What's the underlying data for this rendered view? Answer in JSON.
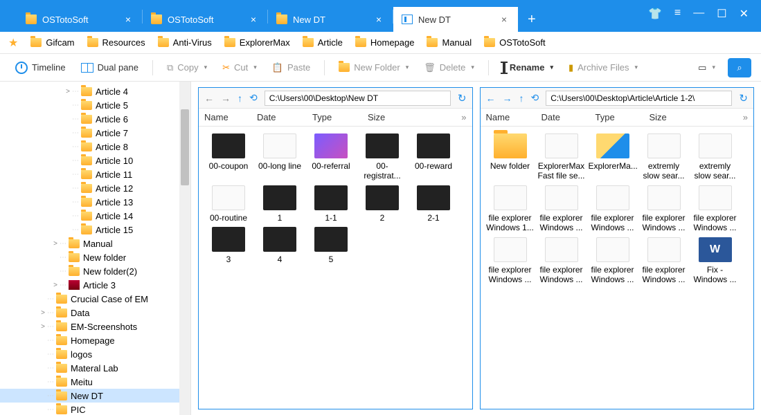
{
  "tabs": [
    {
      "label": "OSTotoSoft",
      "active": false
    },
    {
      "label": "OSTotoSoft",
      "active": false
    },
    {
      "label": "New DT",
      "active": false
    },
    {
      "label": "New DT",
      "active": true
    }
  ],
  "bookmarks": [
    "Gifcam",
    "Resources",
    "Anti-Virus",
    "ExplorerMax",
    "Article",
    "Homepage",
    "Manual",
    "OSTotoSoft"
  ],
  "toolbar": {
    "timeline": "Timeline",
    "dualpane": "Dual pane",
    "copy": "Copy",
    "cut": "Cut",
    "paste": "Paste",
    "newfolder": "New Folder",
    "delete": "Delete",
    "rename": "Rename",
    "archive": "Archive Files"
  },
  "tree": [
    {
      "indent": 3,
      "exp": ">",
      "label": "Article 4"
    },
    {
      "indent": 3,
      "exp": "",
      "label": "Article 5"
    },
    {
      "indent": 3,
      "exp": "",
      "label": "Article 6"
    },
    {
      "indent": 3,
      "exp": "",
      "label": "Article 7"
    },
    {
      "indent": 3,
      "exp": "",
      "label": "Article 8"
    },
    {
      "indent": 3,
      "exp": "",
      "label": "Article 10"
    },
    {
      "indent": 3,
      "exp": "",
      "label": "Article 11"
    },
    {
      "indent": 3,
      "exp": "",
      "label": "Article 12"
    },
    {
      "indent": 3,
      "exp": "",
      "label": "Article 13"
    },
    {
      "indent": 3,
      "exp": "",
      "label": "Article 14"
    },
    {
      "indent": 3,
      "exp": "",
      "label": "Article 15"
    },
    {
      "indent": 2,
      "exp": ">",
      "label": "Manual"
    },
    {
      "indent": 2,
      "exp": "",
      "label": "New folder"
    },
    {
      "indent": 2,
      "exp": "",
      "label": "New folder(2)"
    },
    {
      "indent": 2,
      "exp": ">",
      "label": "Article 3",
      "icon": "rar"
    },
    {
      "indent": 1,
      "exp": "",
      "label": "Crucial Case of EM"
    },
    {
      "indent": 1,
      "exp": ">",
      "label": "Data"
    },
    {
      "indent": 1,
      "exp": ">",
      "label": "EM-Screenshots"
    },
    {
      "indent": 1,
      "exp": "",
      "label": "Homepage"
    },
    {
      "indent": 1,
      "exp": "",
      "label": "logos"
    },
    {
      "indent": 1,
      "exp": "",
      "label": "Materal Lab"
    },
    {
      "indent": 1,
      "exp": "",
      "label": "Meitu"
    },
    {
      "indent": 1,
      "exp": "",
      "label": "New DT",
      "sel": true
    },
    {
      "indent": 1,
      "exp": "",
      "label": "PIC"
    }
  ],
  "left": {
    "path": "C:\\Users\\00\\Desktop\\New DT",
    "cols": [
      "Name",
      "Date",
      "Type",
      "Size"
    ],
    "items": [
      {
        "label": "00-coupon",
        "t": "dark"
      },
      {
        "label": "00-long line",
        "t": "light"
      },
      {
        "label": "00-referral",
        "t": "purple"
      },
      {
        "label": "00-registrat...",
        "t": "dark"
      },
      {
        "label": "00-reward",
        "t": "dark"
      },
      {
        "label": "00-routine",
        "t": "light"
      },
      {
        "label": "1",
        "t": "dark"
      },
      {
        "label": "1-1",
        "t": "dark"
      },
      {
        "label": "2",
        "t": "dark"
      },
      {
        "label": "2-1",
        "t": "dark"
      },
      {
        "label": "3",
        "t": "dark"
      },
      {
        "label": "4",
        "t": "dark"
      },
      {
        "label": "5",
        "t": "dark"
      }
    ]
  },
  "right": {
    "path": "C:\\Users\\00\\Desktop\\Article\\Article 1-2\\",
    "cols": [
      "Name",
      "Date",
      "Type",
      "Size"
    ],
    "items": [
      {
        "label": "New folder",
        "t": "folder"
      },
      {
        "label": "ExplorerMax Fast file se...",
        "t": "light"
      },
      {
        "label": "ExplorerMa...",
        "t": "shield"
      },
      {
        "label": "extremly slow sear...",
        "t": "light"
      },
      {
        "label": "extremly slow sear...",
        "t": "light"
      },
      {
        "label": "file explorer Windows 1...",
        "t": "light"
      },
      {
        "label": "file explorer Windows ...",
        "t": "light"
      },
      {
        "label": "file explorer Windows ...",
        "t": "light"
      },
      {
        "label": "file explorer Windows ...",
        "t": "light"
      },
      {
        "label": "file explorer Windows ...",
        "t": "light"
      },
      {
        "label": "file explorer Windows ...",
        "t": "light"
      },
      {
        "label": "file explorer Windows ...",
        "t": "light"
      },
      {
        "label": "file explorer Windows ...",
        "t": "light"
      },
      {
        "label": "file explorer Windows ...",
        "t": "light"
      },
      {
        "label": "Fix - Windows ...",
        "t": "docx"
      }
    ]
  }
}
